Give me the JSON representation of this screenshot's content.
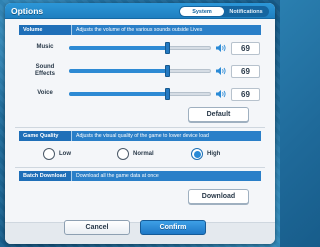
{
  "dialog": {
    "title": "Options"
  },
  "tabs": [
    {
      "label": "System",
      "active": true
    },
    {
      "label": "Notifications",
      "active": false
    }
  ],
  "volume": {
    "label": "Volume",
    "description": "Adjusts the volume of the various sounds outside Lives",
    "music": {
      "label": "Music",
      "value": "69",
      "level": 0.69
    },
    "sound_effects": {
      "label_line1": "Sound",
      "label_line2": "Effects",
      "value": "69",
      "level": 0.69
    },
    "voice": {
      "label": "Voice",
      "value": "69",
      "level": 0.69
    },
    "default_label": "Default"
  },
  "quality": {
    "label": "Game Quality",
    "description": "Adjusts the visual quality of the game to lower device load",
    "options": [
      "Low",
      "Normal",
      "High"
    ],
    "selected": "High"
  },
  "batch": {
    "label": "Batch Download",
    "description": "Download all the game data at once",
    "download_label": "Download"
  },
  "footer": {
    "cancel_label": "Cancel",
    "confirm_label": "Confirm"
  },
  "colors": {
    "accent": "#2a8ad6",
    "header": "#1f7fc0"
  }
}
